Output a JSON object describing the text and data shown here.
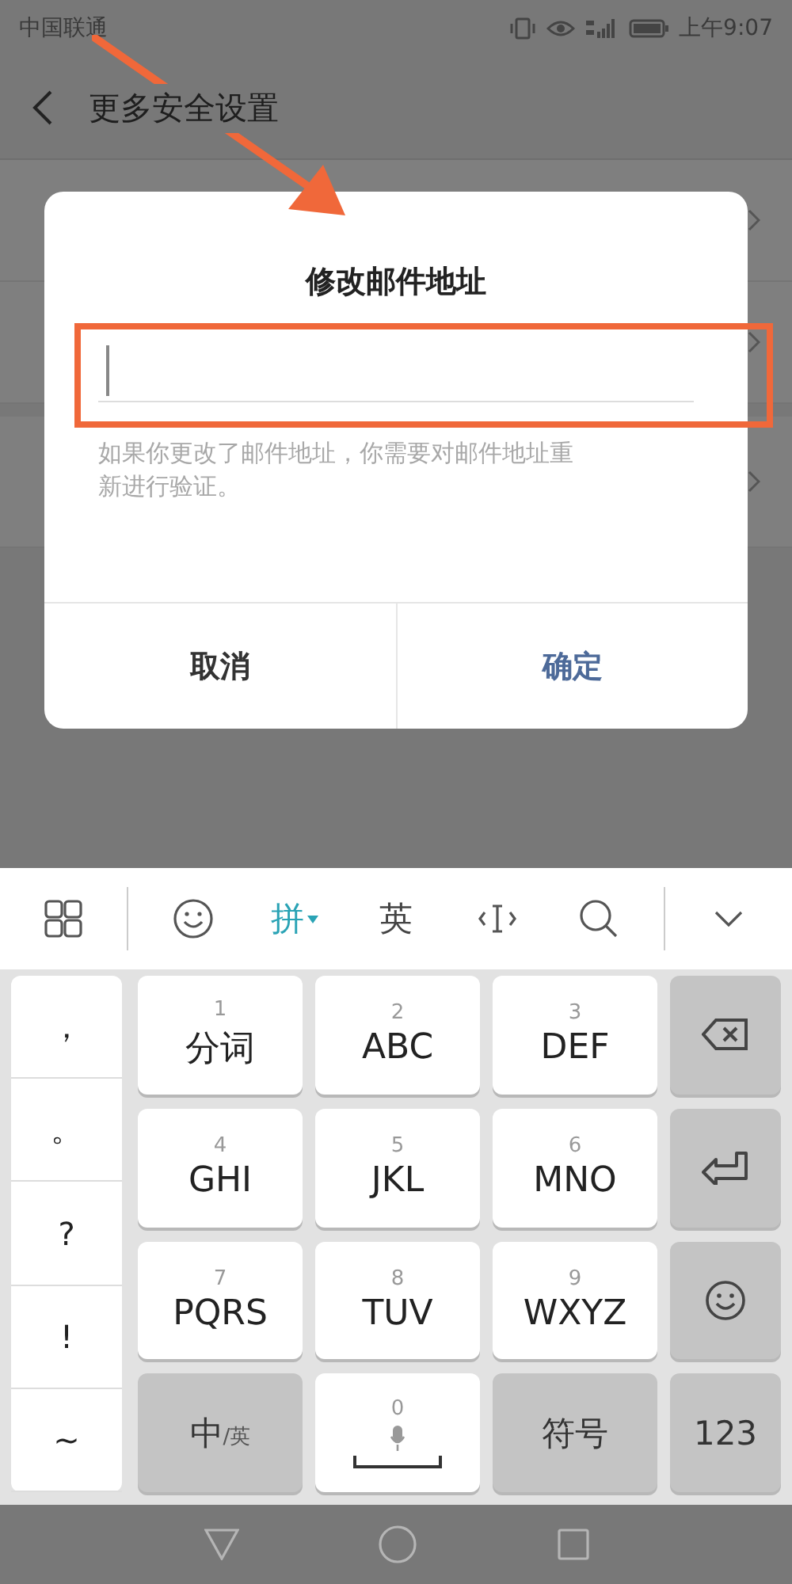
{
  "status_bar": {
    "carrier": "中国联通",
    "time": "上午9:07"
  },
  "header": {
    "title": "更多安全设置"
  },
  "background_rows": [
    {
      "gap_before": false
    },
    {
      "gap_before": false
    },
    {
      "gap_before": true
    }
  ],
  "dialog": {
    "title": "修改邮件地址",
    "input": {
      "focused": true
    },
    "hint": "如果你更改了邮件地址，你需要对邮件地址重新进行验证。",
    "buttons": [
      {
        "label": "取消",
        "kind": "cancel"
      },
      {
        "label": "确定",
        "kind": "confirm"
      }
    ]
  },
  "keyboard": {
    "toolbar": [
      {
        "kind": "grid"
      },
      {
        "kind": "emoji"
      },
      {
        "kind": "text",
        "label": "拼",
        "selected": true
      },
      {
        "kind": "text",
        "label": "英",
        "selected": false
      },
      {
        "kind": "cursor"
      },
      {
        "kind": "search"
      },
      {
        "kind": "collapse"
      }
    ],
    "symbols": [
      "，",
      "。",
      "?",
      "!",
      "~"
    ],
    "keys": [
      {
        "kind": "letter",
        "number": "1",
        "label": "分词"
      },
      {
        "kind": "letter",
        "number": "2",
        "label": "ABC"
      },
      {
        "kind": "letter",
        "number": "3",
        "label": "DEF"
      },
      {
        "kind": "backspace"
      },
      {
        "kind": "letter",
        "number": "4",
        "label": "GHI"
      },
      {
        "kind": "letter",
        "number": "5",
        "label": "JKL"
      },
      {
        "kind": "letter",
        "number": "6",
        "label": "MNO"
      },
      {
        "kind": "enter"
      },
      {
        "kind": "letter",
        "number": "7",
        "label": "PQRS"
      },
      {
        "kind": "letter",
        "number": "8",
        "label": "TUV"
      },
      {
        "kind": "letter",
        "number": "9",
        "label": "WXYZ"
      },
      {
        "kind": "emoji"
      },
      {
        "kind": "lang",
        "label": "中",
        "sub": "/英"
      },
      {
        "kind": "space",
        "number": "0"
      },
      {
        "kind": "func",
        "label": "符号"
      },
      {
        "kind": "func",
        "label": "123"
      }
    ]
  }
}
